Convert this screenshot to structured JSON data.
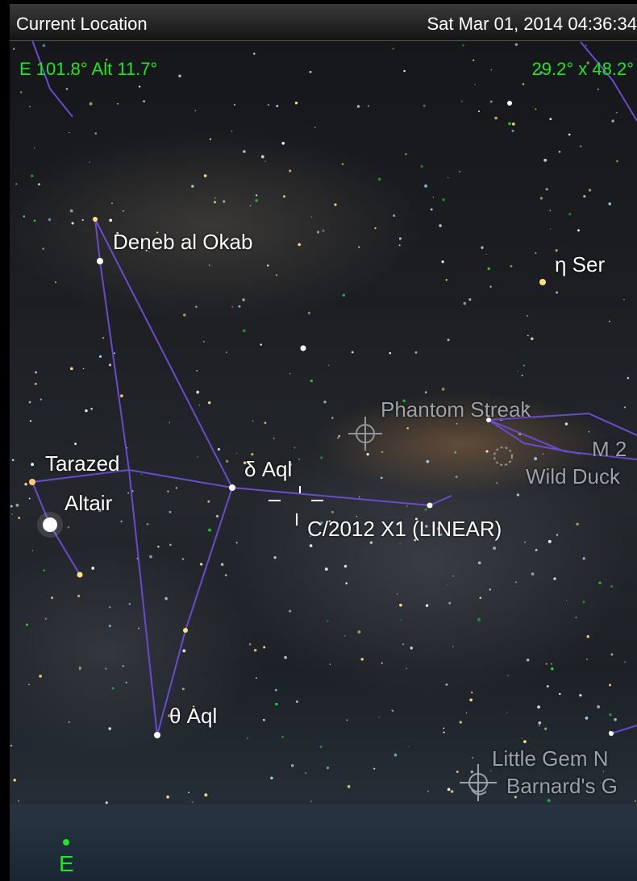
{
  "status_bar": {
    "location": "Current Location",
    "datetime": "Sat Mar 01, 2014  04:36:34"
  },
  "hud": {
    "pointing": "E 101.8° Alt 11.7°",
    "field_of_view": "29.2° x 48.2°"
  },
  "compass": {
    "direction": "E"
  },
  "labels": {
    "deneb_al_okab": "Deneb al Okab",
    "eta_ser": "η Ser",
    "phantom_streak": "Phantom Streak",
    "tarazed": "Tarazed",
    "delta_aql": "δ Aql",
    "altair": "Altair",
    "m2": "M 2",
    "wild_duck": "Wild Duck",
    "comet": "C/2012 X1 (LINEAR)",
    "theta_aql": "θ Aql",
    "little_gem": "Little Gem N",
    "barnards": "Barnard's G"
  },
  "colors": {
    "hud": "#1ee81e",
    "constellation_line": "#6a4bd0",
    "dso_label": "#9aa2ab"
  },
  "icons": {
    "deep_sky": "crosshair-circle-icon",
    "nebula": "nebula-icon"
  }
}
